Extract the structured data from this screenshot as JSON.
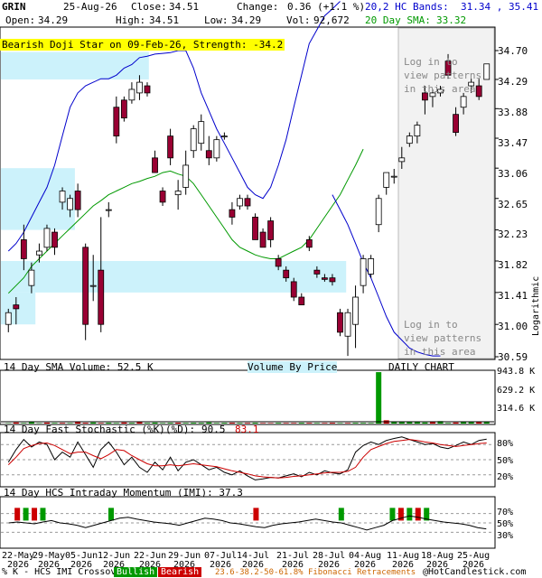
{
  "header": {
    "symbol": "GRIN",
    "date": "25-Aug-26",
    "close_label": "Close:",
    "close_value": "34.51",
    "change_label": "Change:",
    "change_value": "0.36 (+1.1 %)",
    "open_label": "Open:",
    "open_value": "34.29",
    "high_label": "High:",
    "high_value": "34.51",
    "low_label": "Low:",
    "low_value": "34.29",
    "vol_label": "Vol:",
    "vol_value": "92,672",
    "bands_label": "20,2 HC Bands:",
    "bands_value": "31.34 , 35.41",
    "sma_label": "20 Day SMA:",
    "sma_value": "33.32"
  },
  "banner": "Bearish Doji Star on 09-Feb-26, Strength: -34.2",
  "price_axis": {
    "ticks": [
      "34.70",
      "34.29",
      "33.88",
      "33.47",
      "33.06",
      "32.65",
      "32.23",
      "31.82",
      "31.41",
      "31.00",
      "30.59"
    ],
    "scale_label": "Logarithmic"
  },
  "login_note": [
    "Log in to",
    "view patterns",
    "in this area"
  ],
  "volume_panel": {
    "sma_label": "14 Day SMA Volume: 52.5 K",
    "vbp_label": "Volume By Price",
    "daily_label": "DAILY CHART",
    "ticks": [
      "943.8 K",
      "629.2 K",
      "314.6 K"
    ]
  },
  "stoch_panel": {
    "label": "14 Day Fast Stochastic (%K)",
    "d_label": "(%D):",
    "k_value": "90.5",
    "d_value": "83.1",
    "ticks": [
      "80%",
      "50%",
      "20%"
    ]
  },
  "imi_panel": {
    "label": "14 Day HCS Intraday Momentum (IMI): 37.3",
    "ticks": [
      "70%",
      "50%",
      "30%"
    ]
  },
  "x_axis": {
    "labels": [
      {
        "top": "22-May",
        "bottom": "2026"
      },
      {
        "top": "29-May",
        "bottom": "2026"
      },
      {
        "top": "05-Jun",
        "bottom": "2026"
      },
      {
        "top": "12-Jun",
        "bottom": "2026"
      },
      {
        "top": "22-Jun",
        "bottom": "2026"
      },
      {
        "top": "29-Jun",
        "bottom": "2026"
      },
      {
        "top": "07-Jul",
        "bottom": "2026"
      },
      {
        "top": "14-Jul",
        "bottom": "2026"
      },
      {
        "top": "21-Jul",
        "bottom": "2026"
      },
      {
        "top": "28-Jul",
        "bottom": "2026"
      },
      {
        "top": "04-Aug",
        "bottom": "2026"
      },
      {
        "top": "11-Aug",
        "bottom": "2026"
      },
      {
        "top": "18-Aug",
        "bottom": "2026"
      },
      {
        "top": "25-Aug",
        "bottom": "2026"
      }
    ]
  },
  "footer": {
    "crossover": "% K - HCS IMI Crossover:",
    "bullish": "Bullish",
    "bearish": "Bearish",
    "fib": "23.6-38.2-50-61.8% Fibonacci Retracements",
    "copyright": "@HotCandlestick.com"
  },
  "colors": {
    "bull": "#009900",
    "bear": "#990033",
    "band": "#0000cc",
    "sma": "#009900",
    "vbp": "#ccf2fb"
  },
  "chart_data": {
    "type": "candlestick",
    "scale": "log",
    "ylim": [
      30.59,
      34.7
    ],
    "vbp_zones": [
      {
        "low": 34.29,
        "high": 34.68,
        "extent": 0.3
      },
      {
        "low": 32.23,
        "high": 33.06,
        "extent": 0.15
      },
      {
        "low": 31.41,
        "high": 31.82,
        "extent": 0.7
      },
      {
        "low": 31.0,
        "high": 31.41,
        "extent": 0.07
      }
    ],
    "candles": [
      {
        "o": 31.0,
        "h": 31.2,
        "l": 30.9,
        "c": 31.15
      },
      {
        "o": 31.25,
        "h": 31.35,
        "l": 31.0,
        "c": 31.2
      },
      {
        "o": 32.1,
        "h": 32.3,
        "l": 31.7,
        "c": 31.85
      },
      {
        "o": 31.5,
        "h": 31.8,
        "l": 31.4,
        "c": 31.7
      },
      {
        "o": 31.9,
        "h": 32.05,
        "l": 31.8,
        "c": 31.95
      },
      {
        "o": 32.0,
        "h": 32.3,
        "l": 31.95,
        "c": 32.25
      },
      {
        "o": 32.2,
        "h": 32.25,
        "l": 31.9,
        "c": 32.0
      },
      {
        "o": 32.6,
        "h": 32.8,
        "l": 32.5,
        "c": 32.75
      },
      {
        "o": 32.5,
        "h": 32.7,
        "l": 32.4,
        "c": 32.65
      },
      {
        "o": 32.75,
        "h": 32.85,
        "l": 32.4,
        "c": 32.5
      },
      {
        "o": 32.0,
        "h": 32.05,
        "l": 30.8,
        "c": 31.0
      },
      {
        "o": 31.5,
        "h": 31.9,
        "l": 31.3,
        "c": 31.5
      },
      {
        "o": 31.7,
        "h": 32.4,
        "l": 30.9,
        "c": 31.0
      },
      {
        "o": 32.5,
        "h": 32.6,
        "l": 32.4,
        "c": 32.5
      },
      {
        "o": 33.9,
        "h": 34.05,
        "l": 33.4,
        "c": 33.5
      },
      {
        "o": 34.0,
        "h": 34.05,
        "l": 33.7,
        "c": 33.75
      },
      {
        "o": 34.0,
        "h": 34.25,
        "l": 33.95,
        "c": 34.15
      },
      {
        "o": 34.1,
        "h": 34.35,
        "l": 34.0,
        "c": 34.25
      },
      {
        "o": 34.2,
        "h": 34.25,
        "l": 34.05,
        "c": 34.1
      },
      {
        "o": 33.2,
        "h": 33.3,
        "l": 33.0,
        "c": 33.0
      },
      {
        "o": 32.75,
        "h": 32.8,
        "l": 32.55,
        "c": 32.6
      },
      {
        "o": 33.5,
        "h": 33.6,
        "l": 33.1,
        "c": 33.2
      },
      {
        "o": 32.7,
        "h": 32.9,
        "l": 32.5,
        "c": 32.75
      },
      {
        "o": 32.8,
        "h": 33.3,
        "l": 32.7,
        "c": 33.1
      },
      {
        "o": 33.3,
        "h": 33.65,
        "l": 33.2,
        "c": 33.6
      },
      {
        "o": 33.4,
        "h": 33.8,
        "l": 33.3,
        "c": 33.7
      },
      {
        "o": 33.3,
        "h": 33.5,
        "l": 33.1,
        "c": 33.2
      },
      {
        "o": 33.2,
        "h": 33.5,
        "l": 33.15,
        "c": 33.45
      },
      {
        "o": 33.5,
        "h": 33.55,
        "l": 33.45,
        "c": 33.5
      },
      {
        "o": 32.5,
        "h": 32.6,
        "l": 32.3,
        "c": 32.4
      },
      {
        "o": 32.55,
        "h": 32.7,
        "l": 32.5,
        "c": 32.65
      },
      {
        "o": 32.65,
        "h": 32.7,
        "l": 32.5,
        "c": 32.55
      },
      {
        "o": 32.4,
        "h": 32.45,
        "l": 32.1,
        "c": 32.1
      },
      {
        "o": 32.2,
        "h": 32.25,
        "l": 32.0,
        "c": 32.0
      },
      {
        "o": 32.35,
        "h": 32.4,
        "l": 32.0,
        "c": 32.1
      },
      {
        "o": 31.85,
        "h": 31.9,
        "l": 31.7,
        "c": 31.75
      },
      {
        "o": 31.7,
        "h": 31.75,
        "l": 31.55,
        "c": 31.6
      },
      {
        "o": 31.55,
        "h": 31.6,
        "l": 31.3,
        "c": 31.35
      },
      {
        "o": 31.35,
        "h": 31.4,
        "l": 31.25,
        "c": 31.25
      },
      {
        "o": 32.1,
        "h": 32.15,
        "l": 31.95,
        "c": 32.0
      },
      {
        "o": 31.7,
        "h": 31.75,
        "l": 31.6,
        "c": 31.65
      },
      {
        "o": 31.6,
        "h": 31.65,
        "l": 31.55,
        "c": 31.58
      },
      {
        "o": 31.6,
        "h": 31.65,
        "l": 31.5,
        "c": 31.55
      },
      {
        "o": 31.15,
        "h": 31.2,
        "l": 30.85,
        "c": 30.9
      },
      {
        "o": 30.85,
        "h": 31.2,
        "l": 30.6,
        "c": 31.15
      },
      {
        "o": 31.0,
        "h": 31.5,
        "l": 30.7,
        "c": 31.35
      },
      {
        "o": 31.5,
        "h": 31.9,
        "l": 31.4,
        "c": 31.85
      },
      {
        "o": 31.65,
        "h": 31.9,
        "l": 31.6,
        "c": 31.85
      },
      {
        "o": 32.3,
        "h": 32.7,
        "l": 32.2,
        "c": 32.65
      },
      {
        "o": 32.8,
        "h": 33.0,
        "l": 32.7,
        "c": 33.0
      },
      {
        "o": 32.95,
        "h": 33.05,
        "l": 32.85,
        "c": 32.95
      },
      {
        "o": 33.15,
        "h": 33.35,
        "l": 33.05,
        "c": 33.2
      },
      {
        "o": 33.4,
        "h": 33.55,
        "l": 33.35,
        "c": 33.5
      },
      {
        "o": 33.5,
        "h": 33.7,
        "l": 33.4,
        "c": 33.65
      },
      {
        "o": 34.1,
        "h": 34.2,
        "l": 33.8,
        "c": 34.0
      },
      {
        "o": 34.05,
        "h": 34.15,
        "l": 33.9,
        "c": 34.1
      },
      {
        "o": 34.1,
        "h": 34.2,
        "l": 34.05,
        "c": 34.15
      },
      {
        "o": 34.55,
        "h": 34.65,
        "l": 34.3,
        "c": 34.35
      },
      {
        "o": 33.8,
        "h": 33.9,
        "l": 33.5,
        "c": 33.55
      },
      {
        "o": 33.9,
        "h": 34.1,
        "l": 33.8,
        "c": 34.05
      },
      {
        "o": 34.2,
        "h": 34.3,
        "l": 34.1,
        "c": 34.25
      },
      {
        "o": 34.2,
        "h": 34.3,
        "l": 34.0,
        "c": 34.05
      },
      {
        "o": 34.29,
        "h": 34.51,
        "l": 34.29,
        "c": 34.51
      }
    ],
    "upper_band": [
      31.95,
      32.05,
      32.2,
      32.4,
      32.6,
      32.8,
      33.1,
      33.5,
      33.9,
      34.1,
      34.2,
      34.25,
      34.3,
      34.3,
      34.35,
      34.45,
      34.5,
      34.6,
      34.62,
      34.65,
      34.66,
      34.67,
      34.7,
      34.7,
      34.45,
      34.1,
      33.85,
      33.6,
      33.4,
      33.2,
      33.0,
      32.8,
      32.7,
      32.65,
      32.8,
      33.1,
      33.45,
      33.9,
      34.35,
      34.8,
      35.0,
      35.2,
      35.3,
      35.41
    ],
    "sma20": [
      31.4,
      31.5,
      31.6,
      31.75,
      31.85,
      31.95,
      32.05,
      32.15,
      32.25,
      32.35,
      32.45,
      32.55,
      32.62,
      32.7,
      32.75,
      32.8,
      32.85,
      32.88,
      32.92,
      32.95,
      33.0,
      33.02,
      32.98,
      32.95,
      32.85,
      32.7,
      32.55,
      32.4,
      32.25,
      32.1,
      32.0,
      31.95,
      31.9,
      31.87,
      31.85,
      31.85,
      31.9,
      31.95,
      32.0,
      32.1,
      32.25,
      32.4,
      32.55,
      32.7,
      32.9,
      33.1,
      33.32
    ],
    "lower_band": [
      32.7,
      32.5,
      32.3,
      32.05,
      31.8,
      31.6,
      31.35,
      31.1,
      30.9,
      30.8,
      30.7,
      30.65,
      30.62,
      30.6,
      30.6
    ],
    "volume": {
      "ylim": [
        0,
        943.8
      ],
      "unit": "K",
      "values": [
        5,
        20,
        8,
        25,
        6,
        18,
        10,
        12,
        8,
        30,
        14,
        20,
        10,
        15,
        9,
        20,
        12,
        25,
        10,
        18,
        8,
        12,
        16,
        10,
        14,
        12,
        20,
        9,
        12,
        15,
        10,
        11,
        14,
        9,
        8,
        12,
        10,
        10,
        13,
        12,
        9,
        10,
        14,
        8,
        10,
        12,
        11,
        9,
        943,
        60,
        30,
        40,
        35,
        25,
        20,
        30,
        45,
        10,
        20,
        40,
        35,
        40,
        25
      ],
      "bearish_mask": [
        0,
        1,
        0,
        0,
        0,
        1,
        0,
        1,
        0,
        1,
        1,
        0,
        1,
        0,
        0,
        1,
        0,
        1,
        0,
        0,
        0,
        0,
        1,
        0,
        0,
        0,
        0,
        0,
        0,
        1,
        0,
        1,
        0,
        1,
        1,
        0,
        1,
        1,
        0,
        1,
        0,
        1,
        1,
        0,
        1,
        0,
        0,
        0,
        0,
        1,
        0,
        0,
        0,
        0,
        0,
        1,
        0,
        0,
        1,
        0,
        0,
        1,
        0
      ]
    },
    "stochastic": {
      "ylim": [
        0,
        100
      ],
      "k": [
        45,
        70,
        90,
        75,
        85,
        80,
        50,
        65,
        55,
        85,
        60,
        35,
        70,
        85,
        65,
        40,
        55,
        35,
        25,
        45,
        30,
        55,
        28,
        45,
        50,
        40,
        30,
        35,
        25,
        20,
        28,
        18,
        10,
        12,
        15,
        14,
        18,
        22,
        16,
        25,
        20,
        28,
        24,
        22,
        30,
        65,
        78,
        85,
        80,
        88,
        92,
        95,
        90,
        85,
        80,
        82,
        75,
        72,
        78,
        85,
        80,
        88,
        90.5
      ],
      "d": [
        40,
        55,
        72,
        78,
        82,
        83,
        78,
        70,
        62,
        65,
        65,
        58,
        52,
        60,
        70,
        68,
        58,
        50,
        42,
        38,
        38,
        40,
        38,
        40,
        42,
        40,
        38,
        36,
        32,
        28,
        25,
        22,
        18,
        16,
        15,
        14,
        15,
        17,
        18,
        20,
        22,
        24,
        25,
        25,
        27,
        35,
        55,
        70,
        76,
        82,
        86,
        88,
        90,
        88,
        85,
        83,
        80,
        78,
        76,
        78,
        80,
        82,
        83.1
      ]
    },
    "imi": {
      "ylim": [
        0,
        100
      ],
      "values": [
        50,
        52,
        50,
        48,
        52,
        55,
        50,
        48,
        45,
        40,
        45,
        50,
        55,
        60,
        62,
        58,
        55,
        52,
        50,
        48,
        45,
        50,
        55,
        60,
        58,
        55,
        50,
        48,
        45,
        42,
        40,
        45,
        48,
        50,
        52,
        55,
        58,
        55,
        52,
        50,
        45,
        40,
        35,
        40,
        45,
        55,
        60,
        65,
        62,
        58,
        55,
        52,
        50,
        48,
        45,
        40,
        37.3
      ],
      "crossovers": [
        {
          "i": 1,
          "kind": "bear"
        },
        {
          "i": 2,
          "kind": "bull"
        },
        {
          "i": 3,
          "kind": "bear"
        },
        {
          "i": 4,
          "kind": "bull"
        },
        {
          "i": 12,
          "kind": "bull"
        },
        {
          "i": 29,
          "kind": "bear"
        },
        {
          "i": 39,
          "kind": "bull"
        },
        {
          "i": 45,
          "kind": "bull"
        },
        {
          "i": 46,
          "kind": "bear"
        },
        {
          "i": 47,
          "kind": "bull"
        },
        {
          "i": 48,
          "kind": "bear"
        },
        {
          "i": 49,
          "kind": "bull"
        }
      ]
    }
  }
}
